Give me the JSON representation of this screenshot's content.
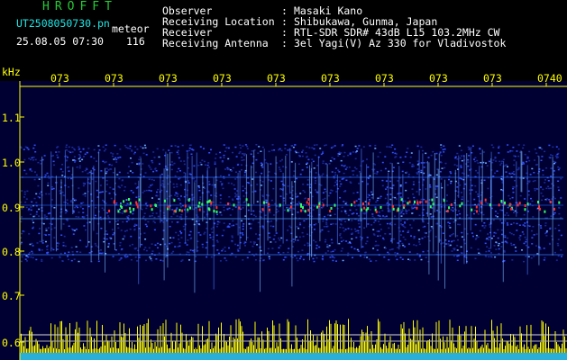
{
  "brand": "HROFFT",
  "file_name": "UT2508050730.pn",
  "mode_label": "meteor",
  "timestamp": "25.08.05 07:30",
  "count": "116",
  "info": [
    {
      "label": "Observer",
      "value": "Masaki Kano"
    },
    {
      "label": "Receiving Location",
      "value": "Shibukawa, Gunma, Japan"
    },
    {
      "label": "Receiver",
      "value": "RTL-SDR SDR# 43dB L15 103.2MHz CW"
    },
    {
      "label": "Receiving Antenna",
      "value": "3el Yagi(V) Az 330 for Vladivostok"
    }
  ],
  "y_unit": "kHz",
  "y_ticks": [
    "1.1",
    "1.0",
    "0.9",
    "0.8",
    "0.7",
    "0.6"
  ],
  "x_ticks": [
    "073",
    "073",
    "073",
    "073",
    "073",
    "073",
    "073",
    "073",
    "073",
    "0740"
  ],
  "colors": {
    "background": "#000000",
    "plot_bg": "#000033",
    "text": "#ffffff",
    "accent_green": "#22cc33",
    "accent_cyan": "#1ee6e6",
    "axis_yellow": "#ffff00",
    "echo_red": "#ff3030",
    "echo_green": "#30ff60",
    "noise_blue": "#3050ff"
  }
}
